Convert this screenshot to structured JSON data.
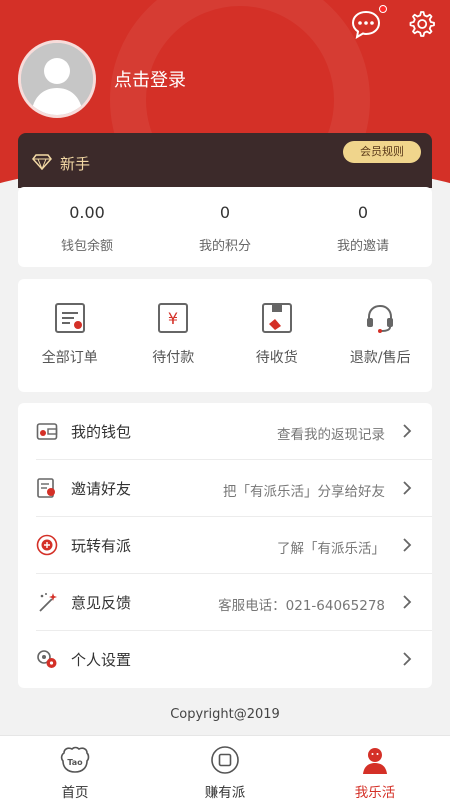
{
  "header": {
    "login_text": "点击登录",
    "member_level": "新手",
    "member_rules": "会员规则",
    "has_notification": true
  },
  "stats": [
    {
      "value": "0.00",
      "label": "钱包余额"
    },
    {
      "value": "0",
      "label": "我的积分"
    },
    {
      "value": "0",
      "label": "我的邀请"
    }
  ],
  "orders": [
    {
      "label": "全部订单",
      "icon": "order-list-icon"
    },
    {
      "label": "待付款",
      "icon": "yuan-payment-icon"
    },
    {
      "label": "待收货",
      "icon": "package-receive-icon"
    },
    {
      "label": "退款/售后",
      "icon": "headset-service-icon"
    }
  ],
  "menu": [
    {
      "label": "我的钱包",
      "desc": "查看我的返现记录",
      "icon": "wallet-icon"
    },
    {
      "label": "邀请好友",
      "desc": "把「有派乐活」分享给好友",
      "icon": "invite-icon"
    },
    {
      "label": "玩转有派",
      "desc": "了解「有派乐活」",
      "icon": "guide-icon"
    },
    {
      "label": "意见反馈",
      "desc": "客服电话：021-64065278",
      "icon": "feedback-wand-icon"
    },
    {
      "label": "个人设置",
      "desc": "",
      "icon": "settings-icon"
    }
  ],
  "footer": {
    "copyright": "Copyright@2019"
  },
  "tabs": [
    {
      "label": "首页",
      "icon": "tao-home-icon",
      "active": false
    },
    {
      "label": "赚有派",
      "icon": "earn-icon",
      "active": false
    },
    {
      "label": "我乐活",
      "icon": "profile-icon",
      "active": true
    }
  ],
  "colors": {
    "brand_red": "#d43027",
    "member_card": "#3c2a2a",
    "member_gold": "#f3d9a5",
    "rules_button": "#f0d58c",
    "page_bg": "#f2f2f2"
  }
}
